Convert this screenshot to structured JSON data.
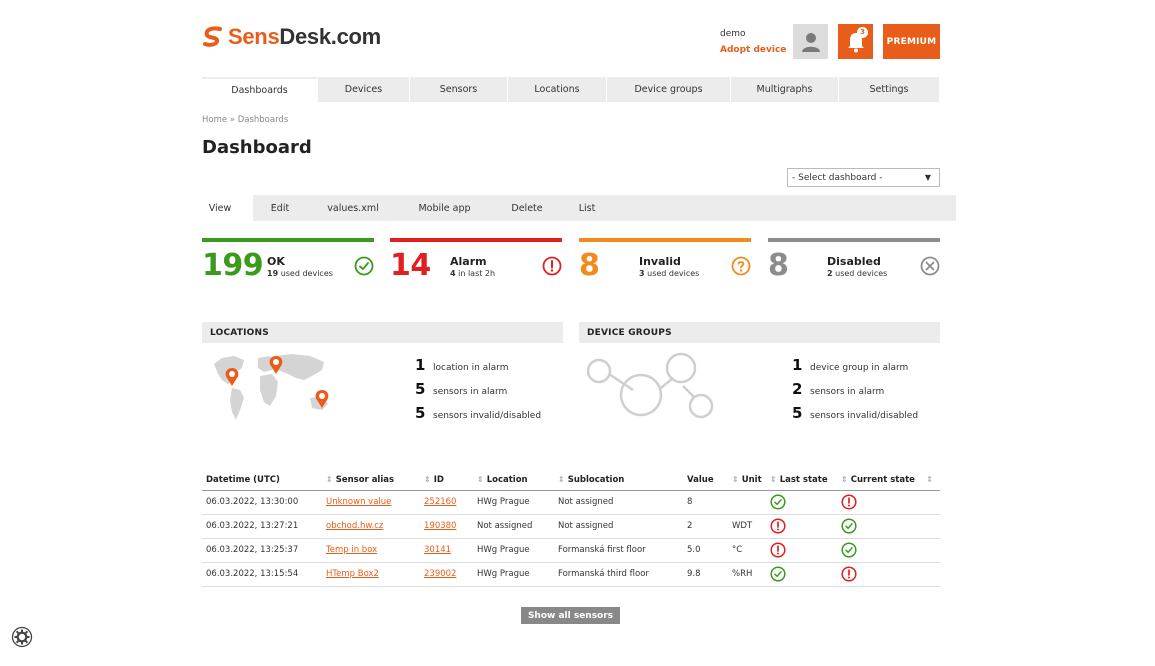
{
  "brand": {
    "name_prefix": "Sens",
    "name_suffix": "Desk.com",
    "accent_color": "#e85d1a"
  },
  "header": {
    "user_name": "demo",
    "adopt_device_label": "Adopt device",
    "notification_count": "3",
    "premium_label": "PREMIUM"
  },
  "main_nav": [
    {
      "label": "Dashboards",
      "active": true
    },
    {
      "label": "Devices"
    },
    {
      "label": "Sensors"
    },
    {
      "label": "Locations"
    },
    {
      "label": "Device groups"
    },
    {
      "label": "Multigraphs"
    },
    {
      "label": "Settings"
    }
  ],
  "breadcrumb": "Home » Dashboards",
  "page_title": "Dashboard",
  "dashboard_select": {
    "value": "- Select dashboard -"
  },
  "sub_tabs": [
    {
      "label": "View",
      "active": true
    },
    {
      "label": "Edit"
    },
    {
      "label": "values.xml"
    },
    {
      "label": "Mobile app"
    },
    {
      "label": "Delete"
    },
    {
      "label": "List"
    }
  ],
  "status_cards": [
    {
      "count": "199",
      "label": "OK",
      "sub_count": "19",
      "sub_text": "used devices",
      "color": "#3a9a1c",
      "icon": "check-circle-icon"
    },
    {
      "count": "14",
      "label": "Alarm",
      "sub_count": "4",
      "sub_text": "in last 2h",
      "color": "#e02020",
      "icon": "alert-circle-icon"
    },
    {
      "count": "8",
      "label": "Invalid",
      "sub_count": "3",
      "sub_text": "used devices",
      "color": "#f28a1c",
      "icon": "question-circle-icon"
    },
    {
      "count": "8",
      "label": "Disabled",
      "sub_count": "2",
      "sub_text": "used devices",
      "color": "#8c8c8c",
      "icon": "x-circle-icon"
    }
  ],
  "locations": {
    "title": "LOCATIONS",
    "stats": [
      {
        "num": "1",
        "text": "location in alarm"
      },
      {
        "num": "5",
        "text": "sensors in alarm"
      },
      {
        "num": "5",
        "text": "sensors invalid/disabled"
      }
    ]
  },
  "device_groups": {
    "title": "DEVICE GROUPS",
    "stats": [
      {
        "num": "1",
        "text": "device group in alarm"
      },
      {
        "num": "2",
        "text": "sensors in alarm"
      },
      {
        "num": "5",
        "text": "sensors invalid/disabled"
      }
    ]
  },
  "table": {
    "headers": [
      "Datetime (UTC)",
      "Sensor alias",
      "ID",
      "Location",
      "Sublocation",
      "Value",
      "Unit",
      "Last state",
      "Current state"
    ],
    "rows": [
      {
        "datetime": "06.03.2022, 13:30:00",
        "alias": "Unknown value",
        "id": "252160",
        "location": "HWg Prague",
        "sublocation": "Not assigned",
        "value": "8",
        "unit": "",
        "last_state": "ok",
        "current_state": "alarm"
      },
      {
        "datetime": "06.03.2022, 13:27:21",
        "alias": "obchod.hw.cz",
        "id": "190380",
        "location": "Not assigned",
        "sublocation": "Not assigned",
        "value": "2",
        "unit": "WDT",
        "last_state": "alarm",
        "current_state": "ok"
      },
      {
        "datetime": "06.03.2022, 13:25:37",
        "alias": "Temp in box",
        "id": "30141",
        "location": "HWg Prague",
        "sublocation": "Formanská first floor",
        "value": "5.0",
        "unit": "°C",
        "last_state": "alarm",
        "current_state": "ok"
      },
      {
        "datetime": "06.03.2022, 13:15:54",
        "alias": "HTemp Box2",
        "id": "239002",
        "location": "HWg Prague",
        "sublocation": "Formanská third floor",
        "value": "9.8",
        "unit": "%RH",
        "last_state": "ok",
        "current_state": "alarm"
      }
    ]
  },
  "show_all_label": "Show all sensors"
}
